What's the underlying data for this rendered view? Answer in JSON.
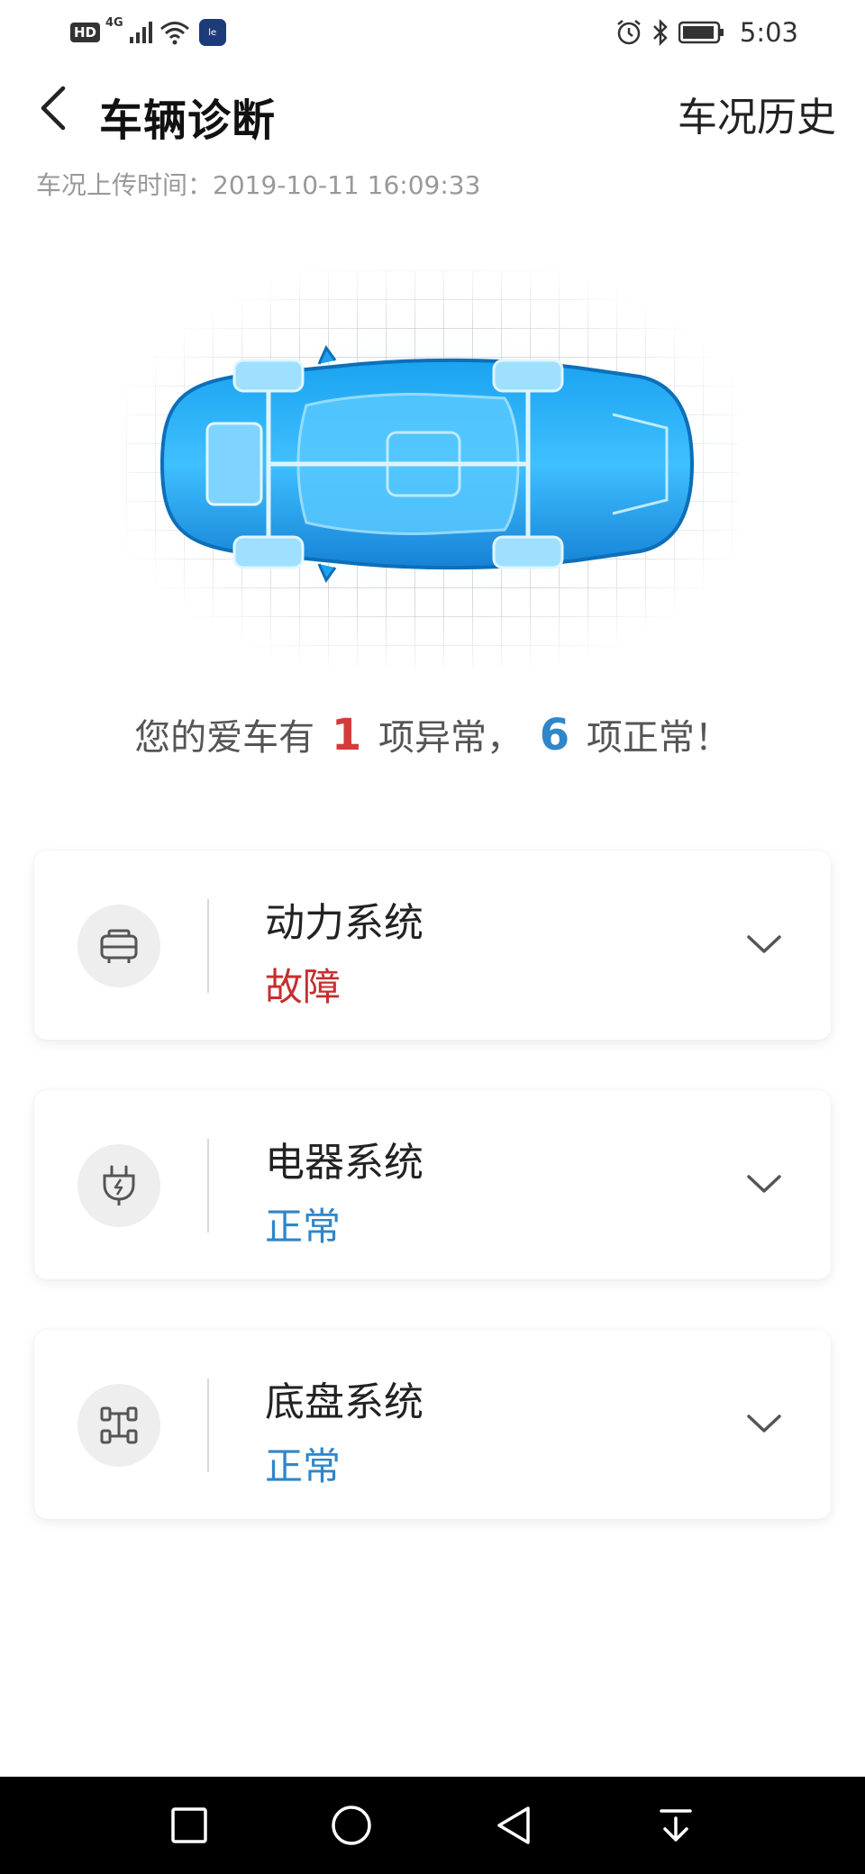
{
  "status_bar": {
    "hd": "HD",
    "network": "4G",
    "app_badge": "le",
    "time": "5:03",
    "icons": [
      "signal-icon",
      "wifi-icon",
      "alarm-icon",
      "bluetooth-icon",
      "battery-icon"
    ]
  },
  "header": {
    "title": "车辆诊断",
    "history_link": "车况历史"
  },
  "upload": {
    "label": "车况上传时间：",
    "time": "2019-10-11 16:09:33"
  },
  "summary": {
    "prefix": "您的爱车有",
    "abnormal_count": "1",
    "middle": "项异常，",
    "normal_count": "6",
    "suffix": "项正常！"
  },
  "systems": [
    {
      "name": "动力系统",
      "status": "故障",
      "icon": "engine-icon"
    },
    {
      "name": "电器系统",
      "status": "正常",
      "icon": "electric-plug-icon"
    },
    {
      "name": "底盘系统",
      "status": "正常",
      "icon": "chassis-icon"
    }
  ],
  "colors": {
    "fault": "#c62e2e",
    "normal": "#2f86c9",
    "car_blue": "#1e8fe0"
  },
  "nav_bar": [
    "recent-apps-icon",
    "home-icon",
    "back-triangle-icon",
    "notification-pull-icon"
  ]
}
